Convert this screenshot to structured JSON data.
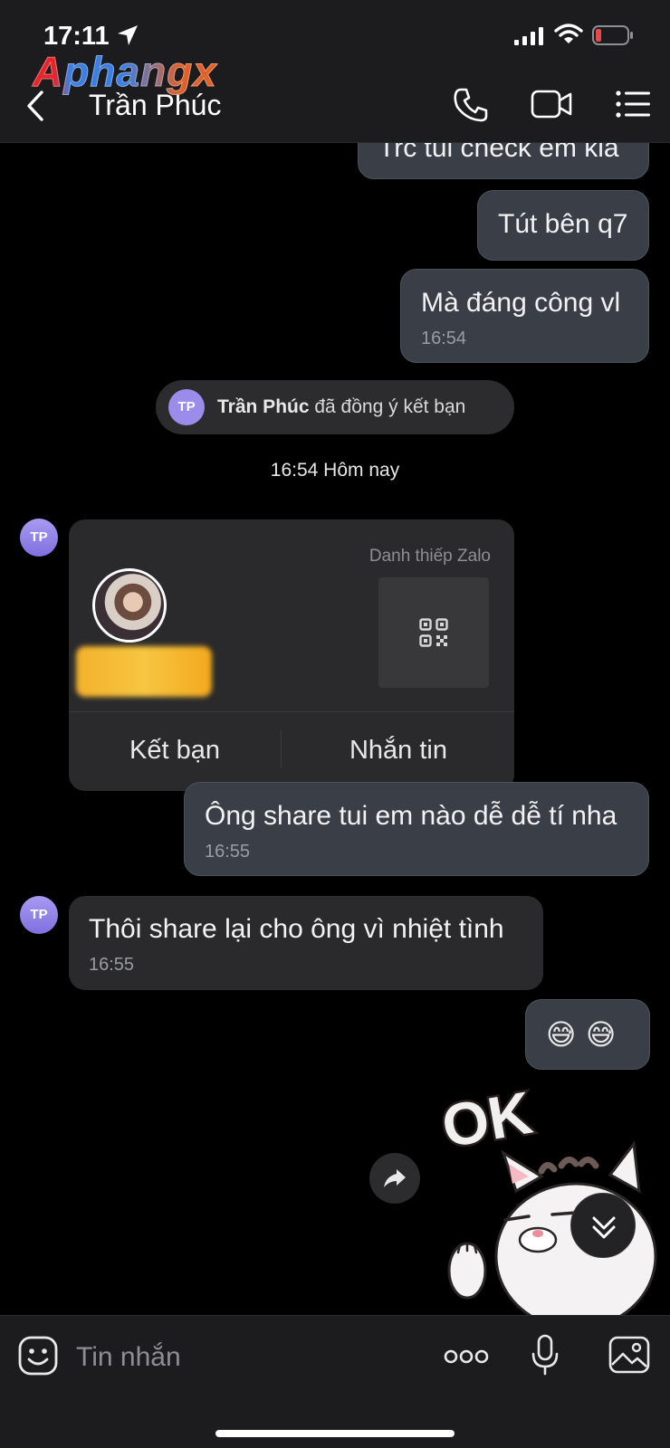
{
  "status_bar": {
    "time": "17:11"
  },
  "header": {
    "watermark": "Aphangx",
    "contact_name": "Trần Phúc"
  },
  "messages": {
    "m1": {
      "text": "Trc tui check em kia"
    },
    "m2": {
      "text": "Tút bên q7"
    },
    "m3": {
      "text": "Mà đáng công vl",
      "time": "16:54"
    },
    "system": {
      "avatar_initials": "TP",
      "name": "Trần Phúc",
      "text": " đã đồng ý kết bạn"
    },
    "date_separator": "16:54 Hôm nay",
    "card": {
      "avatar_initials": "TP",
      "label": "Danh thiếp Zalo",
      "add_friend": "Kết bạn",
      "send_message": "Nhắn tin"
    },
    "m4": {
      "text": "Ông share tui em nào dễ dễ tí nha",
      "time": "16:55"
    },
    "m5": {
      "avatar_initials": "TP",
      "text": "Thôi share lại cho ông vì nhiệt tình",
      "time": "16:55"
    },
    "m6": {
      "emoji_1": "😅",
      "emoji_2": "😅"
    },
    "sticker": {
      "text": "OK"
    }
  },
  "input_bar": {
    "placeholder": "Tin nhắn"
  },
  "colors": {
    "background": "#000000",
    "bar": "#1c1c1e",
    "my_bubble": "#3a3f47",
    "their_bubble": "#2a2a2c",
    "avatar": "#9b8cec",
    "battery_low": "#e5484d"
  }
}
